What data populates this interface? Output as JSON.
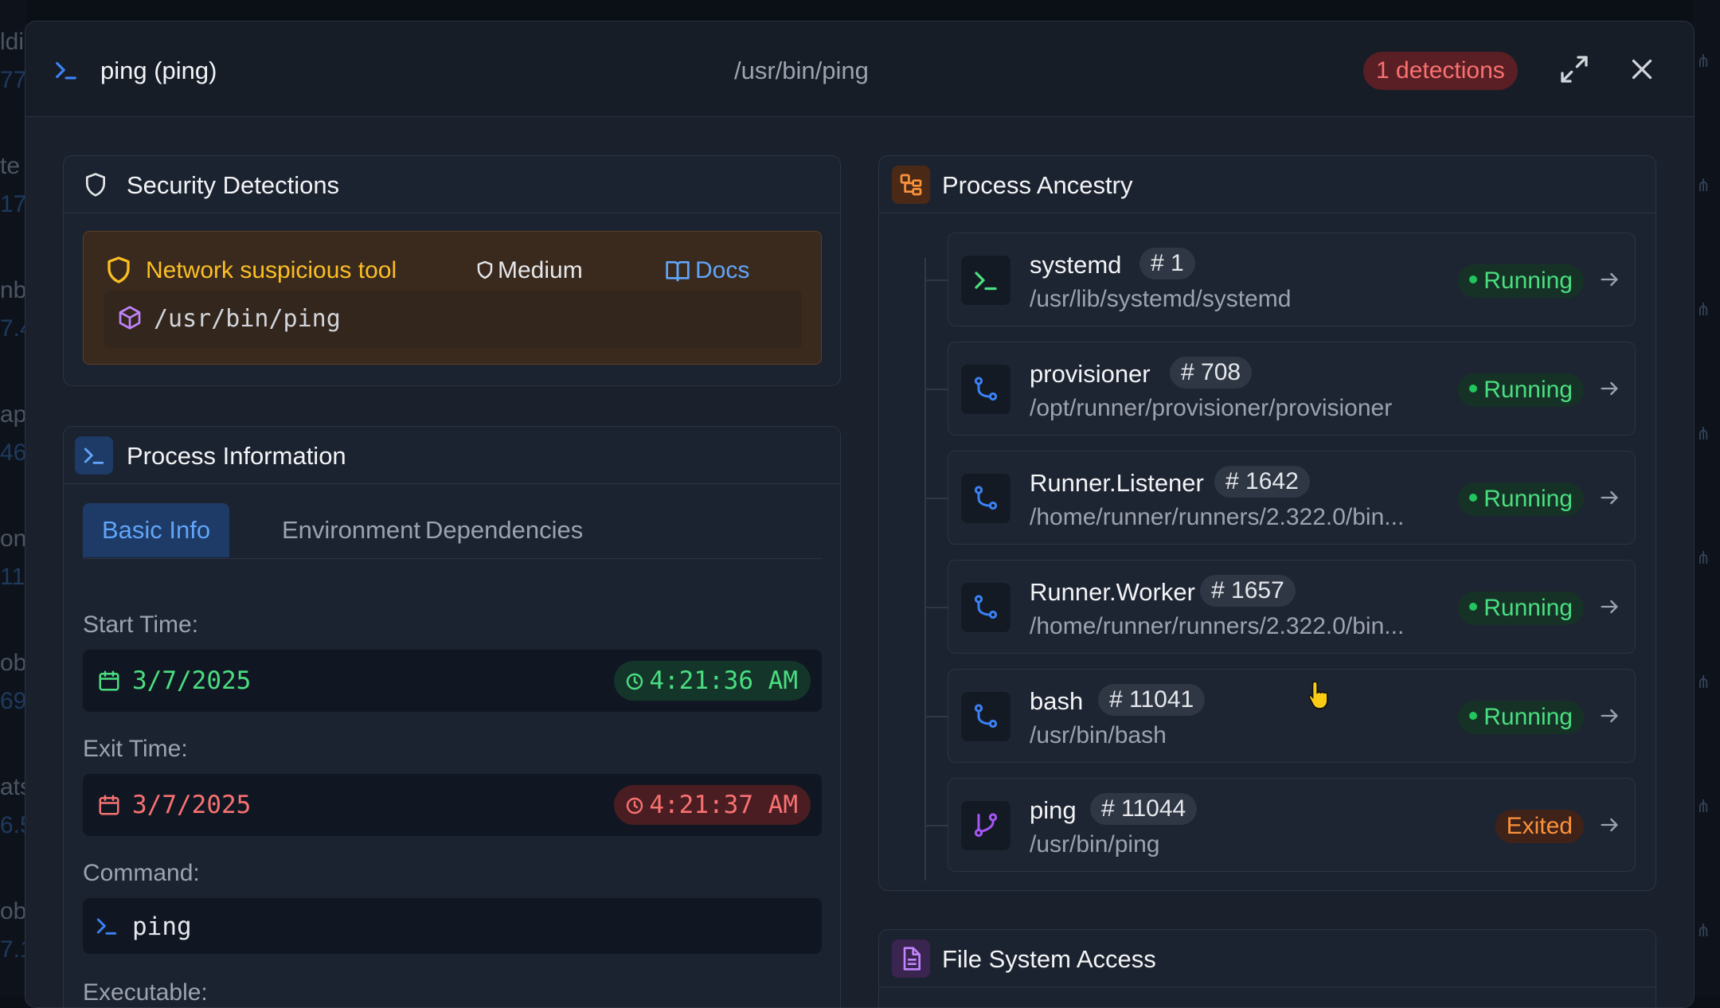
{
  "background": {
    "left_fragments": [
      "ldi",
      "77",
      "te",
      "17.",
      "nb",
      "7.4",
      "ap",
      "46",
      "on",
      "11",
      "ob",
      "69",
      "ats",
      "6.5",
      "ob",
      "7.1"
    ]
  },
  "header": {
    "title": "ping (ping)",
    "path": "/usr/bin/ping",
    "badge": "1 detections"
  },
  "security": {
    "title": "Security Detections",
    "detection": {
      "name": "Network suspicious tool",
      "severity": "Medium",
      "docs_label": "Docs",
      "path": "/usr/bin/ping"
    }
  },
  "process_info": {
    "title": "Process Information",
    "tabs": [
      "Basic Info",
      "Environment",
      "Dependencies"
    ],
    "active_tab": "Basic Info",
    "start_label": "Start Time:",
    "start_date": "3/7/2025",
    "start_time": "4:21:36 AM",
    "exit_label": "Exit Time:",
    "exit_date": "3/7/2025",
    "exit_time": "4:21:37 AM",
    "command_label": "Command:",
    "command": "ping",
    "executable_label": "Executable:"
  },
  "ancestry": {
    "title": "Process Ancestry",
    "nodes": [
      {
        "name": "systemd",
        "pid": "# 1",
        "path": "/usr/lib/systemd/systemd",
        "status": "Running"
      },
      {
        "name": "provisioner",
        "pid": "# 708",
        "path": "/opt/runner/provisioner/provisioner",
        "status": "Running"
      },
      {
        "name": "Runner.Listener",
        "pid": "# 1642",
        "path": "/home/runner/runners/2.322.0/bin...",
        "status": "Running"
      },
      {
        "name": "Runner.Worker",
        "pid": "# 1657",
        "path": "/home/runner/runners/2.322.0/bin...",
        "status": "Running"
      },
      {
        "name": "bash",
        "pid": "# 11041",
        "path": "/usr/bin/bash",
        "status": "Running"
      },
      {
        "name": "ping",
        "pid": "# 11044",
        "path": "/usr/bin/ping",
        "status": "Exited"
      }
    ]
  },
  "file_system": {
    "title": "File System Access"
  },
  "colors": {
    "accent": "#60a5fa",
    "danger": "#f87171",
    "warning": "#fbbf24",
    "success": "#4ade80",
    "exited": "#fb923c",
    "background": "#1a212d"
  }
}
